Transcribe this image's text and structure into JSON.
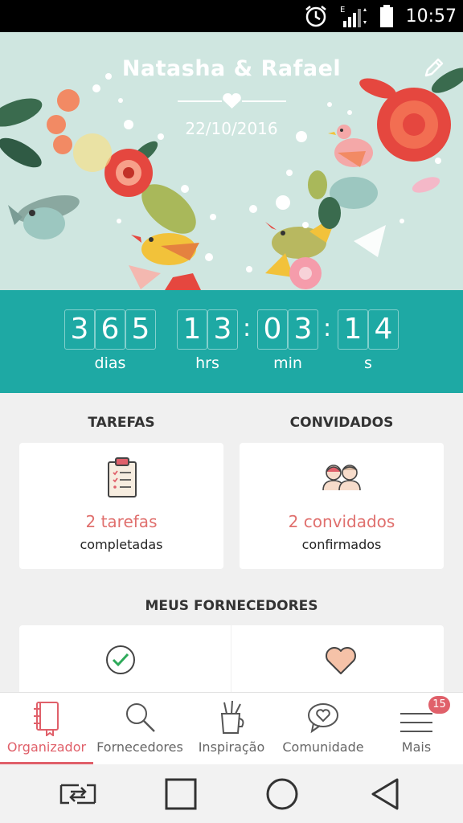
{
  "status_bar": {
    "time": "10:57"
  },
  "header": {
    "names": "Natasha & Rafael",
    "date": "22/10/2016"
  },
  "countdown": {
    "days": [
      "3",
      "6",
      "5"
    ],
    "hours": [
      "1",
      "3"
    ],
    "minutes": [
      "0",
      "3"
    ],
    "seconds": [
      "1",
      "4"
    ],
    "labels": {
      "days": "dias",
      "hours": "hrs",
      "minutes": "min",
      "seconds": "s"
    }
  },
  "tasks": {
    "title": "TAREFAS",
    "count": "2 tarefas",
    "status": "completadas"
  },
  "guests": {
    "title": "CONVIDADOS",
    "count": "2 convidados",
    "status": "confirmados"
  },
  "vendors": {
    "title": "MEUS FORNECEDORES"
  },
  "bottom_nav": {
    "items": [
      {
        "label": "Organizador",
        "icon": "notebook-icon",
        "active": true
      },
      {
        "label": "Fornecedores",
        "icon": "search-icon"
      },
      {
        "label": "Inspiração",
        "icon": "tools-cup-icon"
      },
      {
        "label": "Comunidade",
        "icon": "chat-heart-icon"
      },
      {
        "label": "Mais",
        "icon": "menu-icon"
      }
    ],
    "badge": "15"
  },
  "colors": {
    "teal": "#1ea9a4",
    "mint": "#cfe6e0",
    "accent": "#e0606a"
  }
}
